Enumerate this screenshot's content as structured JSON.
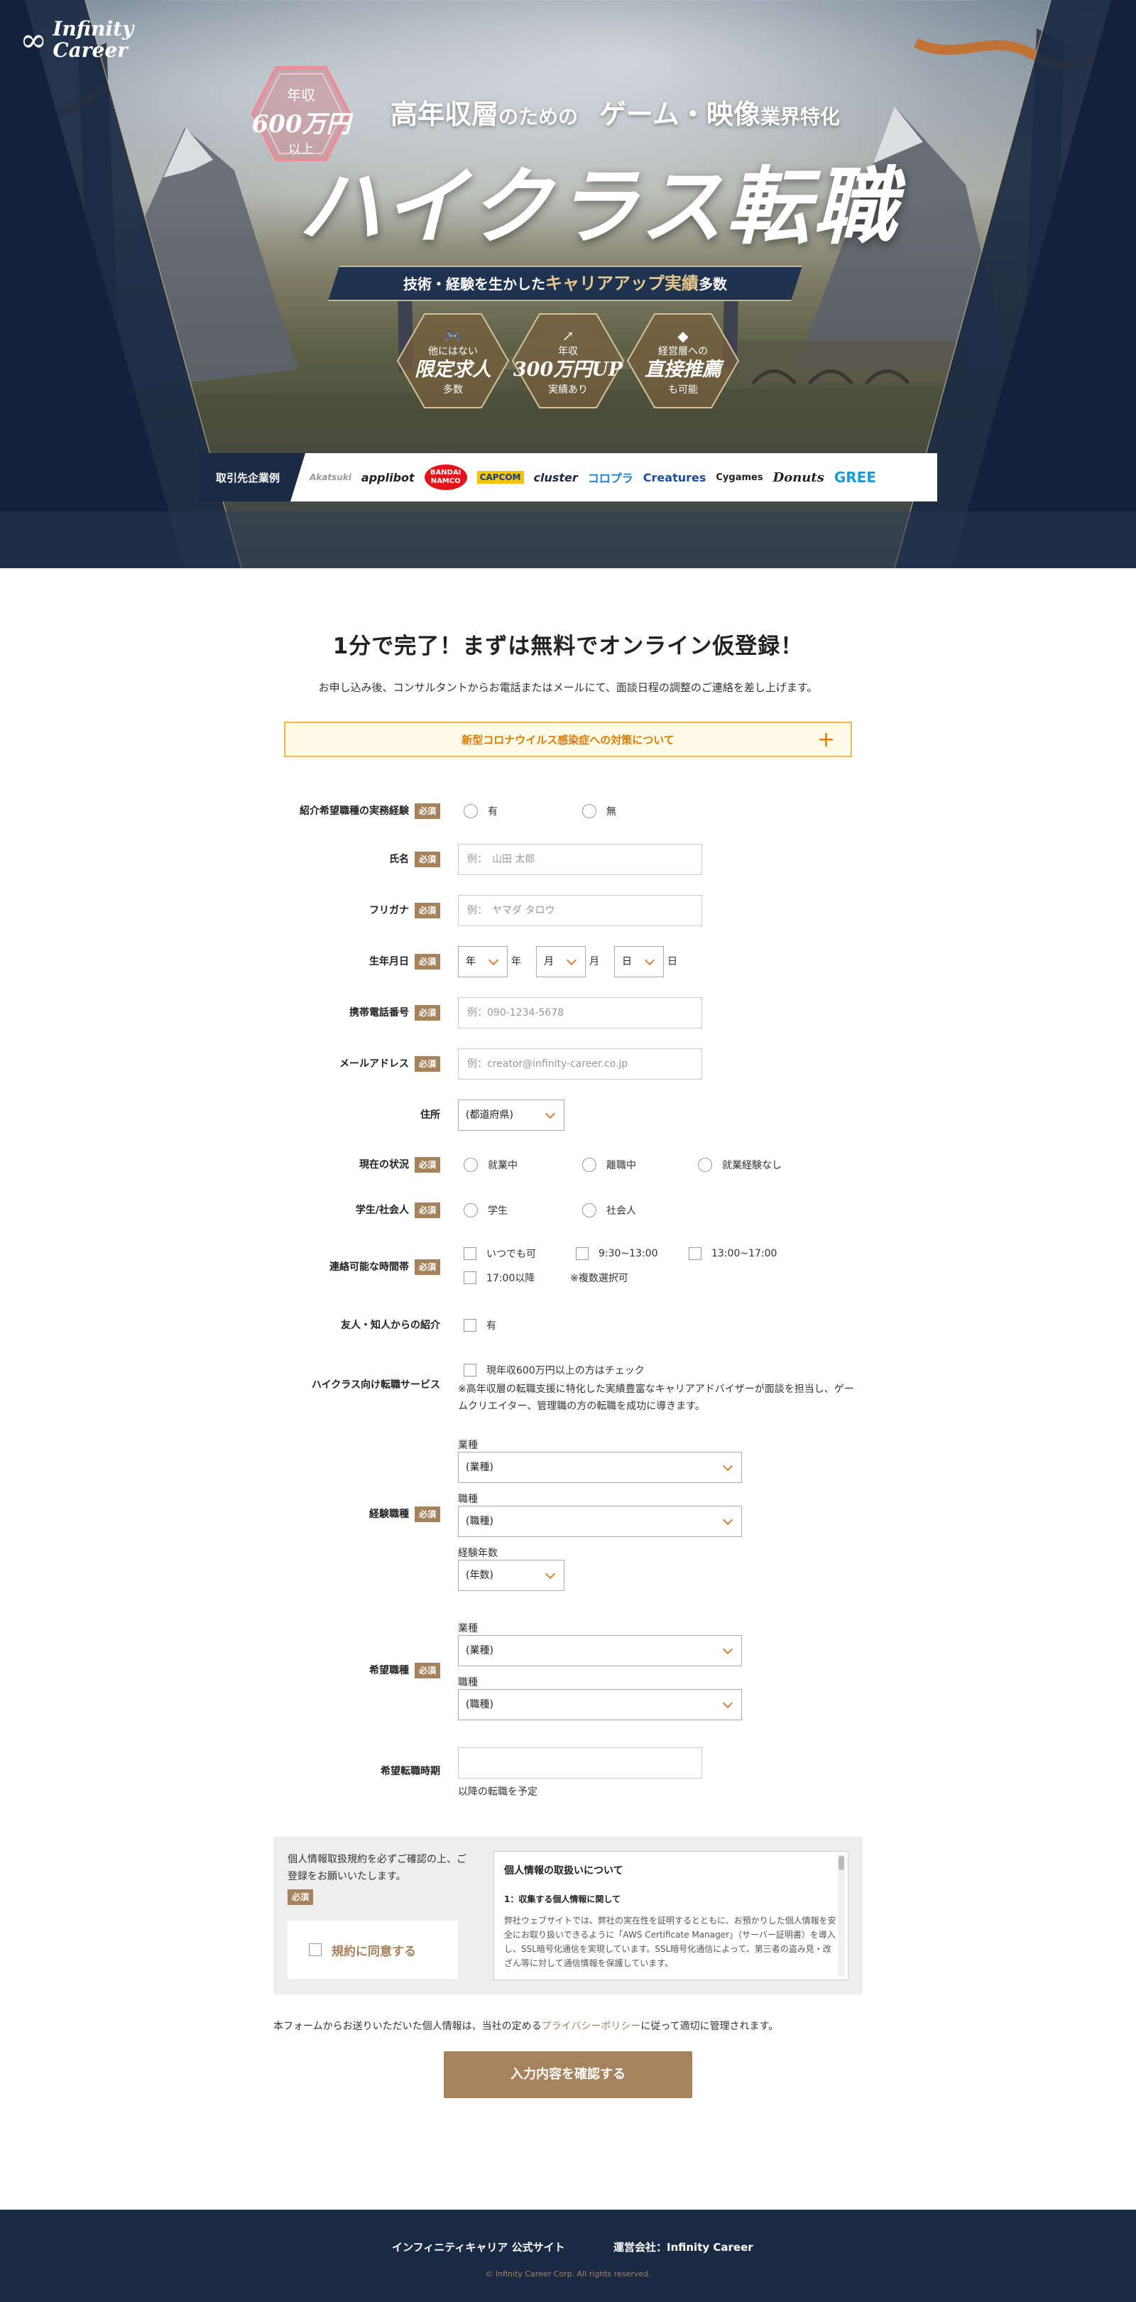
{
  "hero": {
    "logo": {
      "symbol": "∞",
      "line1": "Infinity",
      "line2": "Career"
    },
    "badge": {
      "line1": "年収",
      "line2": "600万円",
      "line3": "以上"
    },
    "tagline": {
      "part1": "高年収層",
      "part2": "のための",
      "part3": "ゲーム・映像",
      "part4": "業界特化"
    },
    "headline": "ハイクラス転職",
    "ribbon": {
      "text1": "技術・経験を生かした",
      "emph": "キャリアアップ実績",
      "text2": "多数"
    },
    "features": [
      {
        "icon": "🎮",
        "small1": "他にはない",
        "big": "限定求人",
        "small2": "多数"
      },
      {
        "icon": "↗",
        "small1": "年収",
        "big": "300万円UP",
        "small2": "実績あり"
      },
      {
        "icon": "◆",
        "small1": "経営層への",
        "big": "直接推薦",
        "small2": "も可能"
      }
    ],
    "clients": {
      "label": "取引先企業例",
      "logos": [
        "Akatsuki",
        "applibot",
        "BANDAI NAMCO",
        "CAPCOM",
        "cluster",
        "コロプラ",
        "Creatures",
        "Cygames",
        "Donuts",
        "GREE"
      ]
    }
  },
  "form": {
    "title": "1分で完了！まずは無料でオンライン仮登録！",
    "lead": "お申し込み後、コンサルタントからお電話またはメールにて、面談日程の調整のご連絡を差し上げます。",
    "covid": "新型コロナウイルス感染症への対策について",
    "covid_toggle": "+",
    "required": "必須",
    "exp": {
      "label": "紹介希望職種の実務経験",
      "opt1": "有",
      "opt2": "無"
    },
    "name": {
      "label": "氏名",
      "placeholder": "例：　山田 太郎"
    },
    "kana": {
      "label": "フリガナ",
      "placeholder": "例：　ヤマダ タロウ"
    },
    "birth": {
      "label": "生年月日",
      "year_sel": "年",
      "year_unit": "年",
      "month_sel": "月",
      "month_unit": "月",
      "day_sel": "日",
      "day_unit": "日"
    },
    "phone": {
      "label": "携帯電話番号",
      "placeholder": "例：090-1234-5678"
    },
    "email": {
      "label": "メールアドレス",
      "placeholder": "例：creator@infinity-career.co.jp"
    },
    "address": {
      "label": "住所",
      "value": "(都道府県)"
    },
    "status": {
      "label": "現在の状況",
      "opt1": "就業中",
      "opt2": "離職中",
      "opt3": "就業経験なし"
    },
    "student": {
      "label": "学生/社会人",
      "opt1": "学生",
      "opt2": "社会人"
    },
    "time": {
      "label": "連絡可能な時間帯",
      "opt1": "いつでも可",
      "opt2": "9:30~13:00",
      "opt3": "13:00~17:00",
      "opt4": "17:00以降",
      "note": "※複数選択可"
    },
    "friend": {
      "label": "友人・知人からの紹介",
      "opt1": "有"
    },
    "highclass": {
      "label": "ハイクラス向け転職サービス",
      "opt1": "現年収600万円以上の方はチェック",
      "desc1": "※高年収層の転職支援に特化した実績豊富なキャリアアドバイザーが面談を担当し、ゲー",
      "desc2": "ムクリエイター、管理職の方の転職を成功に導きます。"
    },
    "experience": {
      "label": "経験職種",
      "industry_lbl": "業種",
      "industry": "(業種)",
      "job_lbl": "職種",
      "job": "(職種)",
      "years_lbl": "経験年数",
      "years": "(年数)"
    },
    "desired": {
      "label": "希望職種",
      "industry_lbl": "業種",
      "industry": "(業種)",
      "job_lbl": "職種",
      "job": "(職種)"
    },
    "timing": {
      "label": "希望転職時期",
      "value": "",
      "suffix": "以降の転職を予定"
    },
    "privacy": {
      "intro": "個人情報取扱規約を必ずご確認の上、ご登録をお願いいたします。",
      "agree": "規約に同意する",
      "box_title": "個人情報の取扱いについて",
      "box_h2": "1：収集する個人情報に関して",
      "box_p": "弊社ウェブサイトでは、弊社の実在性を証明するとともに、お預かりした個人情報を安全にお取り扱いできるように「AWS Certificate Manager」（サーバー証明書）を導入し、SSL暗号化通信を実現しています。SSL暗号化通信によって、第三者の盗み見・改ざん等に対して通信情報を保護しています。"
    },
    "note": {
      "pre": "本フォームからお送りいただいた個人情報は、当社の定める",
      "link": "プライバシーポリシー",
      "post": "に従って適切に管理されます。"
    },
    "submit": "入力内容を確認する"
  },
  "footer": {
    "link1": "インフィニティキャリア 公式サイト",
    "link2": "運営会社：Infinity Career",
    "copy": "© Infinity Career Corp. All rights reserved."
  }
}
